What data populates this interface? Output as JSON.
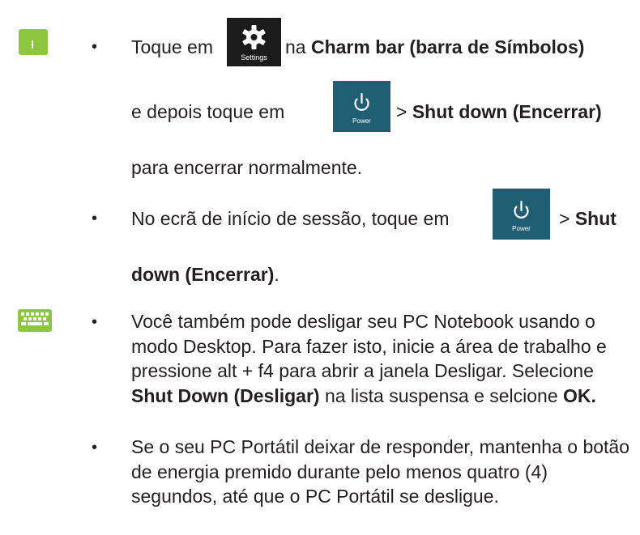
{
  "icons": {
    "touch": "touch-gesture-icon",
    "keyboard": "keyboard-icon",
    "settings_label": "Settings",
    "power_label": "Power"
  },
  "colors": {
    "accent_green": "#8dc63f",
    "settings_tile": "#1b1b1b",
    "power_tile": "#1f5e73"
  },
  "bullet_char": "•",
  "section1": {
    "item1": {
      "prefix": "Toque em",
      "mid": "na",
      "bold1": "Charm bar (barra de Símbolos)",
      "line2_prefix": "e depois toque em",
      "line2_gt": ">",
      "bold2": "Shut down (Encerrar)",
      "line3": "para encerrar normalmente."
    },
    "item2": {
      "prefix": "No ecrã de início de sessão, toque em",
      "gt": ">",
      "bold1": "Shut",
      "bold2": "down (Encerrar)",
      "end": "."
    }
  },
  "section2": {
    "item1": {
      "text1": "Você também pode desligar seu PC Notebook usando o modo Desktop. Para fazer isto, inicie a área de trabalho e pressione alt + f4 para abrir a janela Desligar. Selecione",
      "bold1": "Shut Down (Desligar)",
      "text2": "na lista suspensa e selcione",
      "bold2": "OK."
    },
    "item2": {
      "text": "Se o seu PC Portátil deixar de responder, mantenha o botão de energia premido durante pelo menos quatro (4) segundos, até que o PC Portátil se desligue."
    }
  }
}
